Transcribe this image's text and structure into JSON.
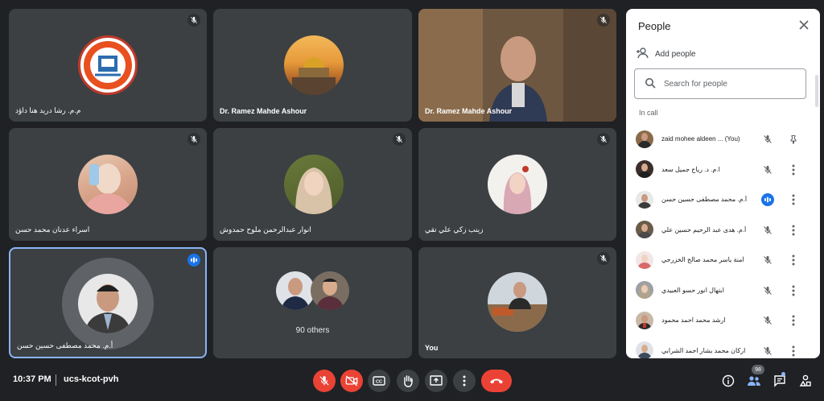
{
  "tiles": [
    {
      "name": "م.م. رشا دريد هنا داؤد",
      "muted": true,
      "kind": "logo"
    },
    {
      "name": "Dr. Ramez Mahde Ashour",
      "muted": false,
      "kind": "photo-city"
    },
    {
      "name": "Dr. Ramez Mahde Ashour",
      "muted": true,
      "kind": "video"
    },
    {
      "name": "اسراء عدنان محمد حسن",
      "muted": true,
      "kind": "photo"
    },
    {
      "name": "انوار عبدالرحمن ملوح حمدوش",
      "muted": true,
      "kind": "photo"
    },
    {
      "name": "زينب زكي علي تقي",
      "muted": true,
      "kind": "photo"
    },
    {
      "name": "أ.م. محمد مصطفى حسين حسن",
      "muted": false,
      "speaking": true,
      "kind": "photo"
    },
    {
      "name": "",
      "others_label": "90 others",
      "kind": "group"
    },
    {
      "name": "You",
      "muted": true,
      "kind": "photo"
    }
  ],
  "panel": {
    "title": "People",
    "add_people": "Add people",
    "search_placeholder": "Search for people",
    "section": "In call",
    "participants": [
      {
        "name": "zaid mohee aldeen ...",
        "suffix": "(You)",
        "mic": "muted",
        "action": "pin"
      },
      {
        "name": "ا.م. د. رياح جميل سعد",
        "mic": "muted",
        "action": "more"
      },
      {
        "name": "أ.م. محمد مصطفى حسين حسن",
        "mic": "speaking",
        "action": "more"
      },
      {
        "name": "أ.م. هدى عبد الرحيم حسين علي",
        "mic": "muted",
        "action": "more"
      },
      {
        "name": "آمنة ياسر محمد صالح الخزرجي",
        "mic": "muted",
        "action": "more"
      },
      {
        "name": "ابتهال انور حسو العبيدي",
        "mic": "muted",
        "action": "more"
      },
      {
        "name": "ارشد محمد احمد محمود",
        "mic": "muted",
        "action": "more"
      },
      {
        "name": "اركان محمد بشار احمد الشرابي",
        "mic": "muted",
        "action": "more"
      }
    ]
  },
  "bottom": {
    "time": "10:37 PM",
    "meeting_code": "ucs-kcot-pvh",
    "people_count": "98"
  },
  "colors": {
    "bg": "#202124",
    "tile": "#3c4043",
    "red": "#ea4335",
    "blue": "#1a73e8",
    "active": "#8ab4f8"
  }
}
